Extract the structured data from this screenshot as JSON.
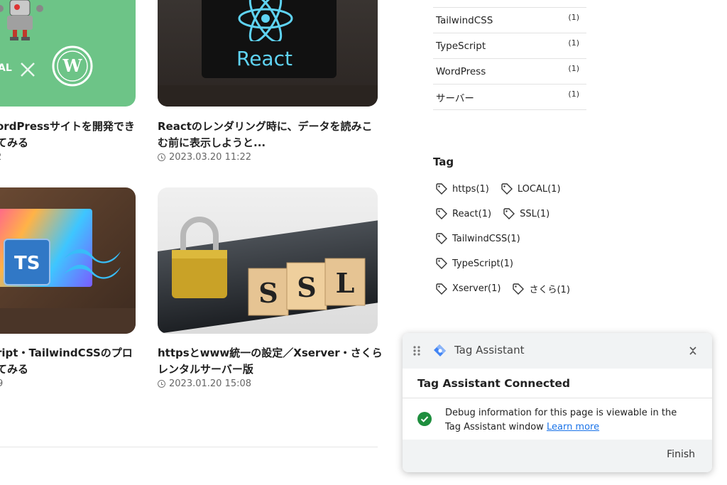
{
  "cards": [
    {
      "title_line1": "ordPressサイトを開発でき",
      "title_line2": "てみる",
      "date": "2"
    },
    {
      "title_line1": "Reactのレンダリング時に、データを読みこ",
      "title_line2": "む前に表示しようと...",
      "date": "2023.03.20 11:22",
      "image_text": "React"
    },
    {
      "title_line1": "ript・TailwindCSSのプロ",
      "title_line2": "てみる",
      "date": "9",
      "image_text": "TS"
    },
    {
      "title_line1": "httpsとwww統一の設定／Xserver・さくら",
      "title_line2": "レンタルサーバー版",
      "date": "2023.01.20 15:08",
      "image_text": "SSL"
    }
  ],
  "card1_image_text": "AL",
  "categories": [
    {
      "name": "TailwindCSS",
      "count": "(1)"
    },
    {
      "name": "TypeScript",
      "count": "(1)"
    },
    {
      "name": "WordPress",
      "count": "(1)"
    },
    {
      "name": "サーバー",
      "count": "(1)"
    }
  ],
  "tag_heading": "Tag",
  "tags": [
    "https(1)",
    "LOCAL(1)",
    "React(1)",
    "SSL(1)",
    "TailwindCSS(1)",
    "TypeScript(1)",
    "Xserver(1)",
    "さくら(1)"
  ],
  "tag_assistant": {
    "title": "Tag Assistant",
    "connected": "Tag Assistant Connected",
    "message": "Debug information for this page is viewable in the Tag Assistant window",
    "learn_more": "Learn more",
    "finish": "Finish"
  },
  "colors": {
    "green_card": "#6dc487",
    "link": "#1a73e8",
    "success": "#1e8e3e",
    "ta_header": "#f1f3f4"
  }
}
